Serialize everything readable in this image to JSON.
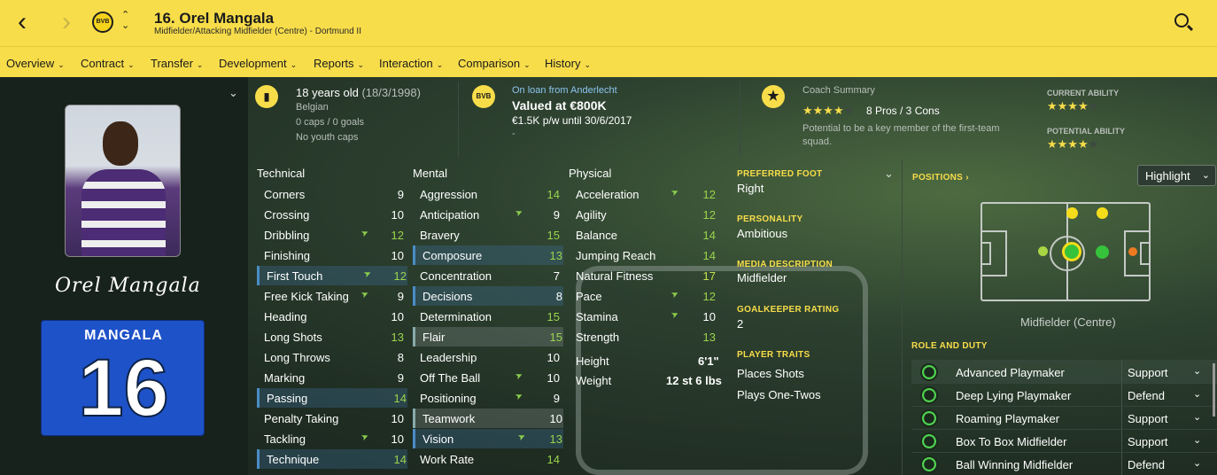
{
  "header": {
    "title": "16. Orel Mangala",
    "subtitle": "Midfielder/Attacking Midfielder (Centre) - Dortmund II",
    "club_crest_text": "BVB",
    "nav_back": "‹",
    "nav_forward": "›",
    "accent": "#f8dd4a"
  },
  "menu": [
    {
      "label": "Overview"
    },
    {
      "label": "Contract"
    },
    {
      "label": "Transfer"
    },
    {
      "label": "Development"
    },
    {
      "label": "Reports"
    },
    {
      "label": "Interaction"
    },
    {
      "label": "Comparison"
    },
    {
      "label": "History"
    }
  ],
  "profile": {
    "signature": "Orel Mangala",
    "shirt_name": "MANGALA",
    "shirt_number": "16"
  },
  "bio": {
    "age": "18 years old",
    "dob": "(18/3/1998)",
    "nationality": "Belgian",
    "caps": "0 caps / 0 goals",
    "youth_caps": "No youth caps"
  },
  "contract": {
    "loan": "On loan from Anderlecht",
    "value": "Valued at €800K",
    "wage": "€1.5K p/w until 30/6/2017",
    "dash": "-"
  },
  "coach": {
    "heading": "Coach Summary",
    "rating_stars": 4,
    "pros_cons": "8 Pros / 3 Cons",
    "summary": "Potential to be a key member of the first-team squad.",
    "current_ability_label": "CURRENT ABILITY",
    "current_ability_stars": 4,
    "potential_ability_label": "POTENTIAL ABILITY",
    "potential_ability_stars": 4
  },
  "attributes": {
    "technical_title": "Technical",
    "mental_title": "Mental",
    "physical_title": "Physical",
    "technical": [
      {
        "name": "Corners",
        "value": "9",
        "arrow": false,
        "hl": "",
        "color": "white"
      },
      {
        "name": "Crossing",
        "value": "10",
        "arrow": false,
        "hl": "",
        "color": "white"
      },
      {
        "name": "Dribbling",
        "value": "12",
        "arrow": true,
        "hl": "",
        "color": "green"
      },
      {
        "name": "Finishing",
        "value": "10",
        "arrow": false,
        "hl": "",
        "color": "white"
      },
      {
        "name": "First Touch",
        "value": "12",
        "arrow": true,
        "hl": "blue",
        "color": "green"
      },
      {
        "name": "Free Kick Taking",
        "value": "9",
        "arrow": true,
        "hl": "",
        "color": "white"
      },
      {
        "name": "Heading",
        "value": "10",
        "arrow": false,
        "hl": "",
        "color": "white"
      },
      {
        "name": "Long Shots",
        "value": "13",
        "arrow": false,
        "hl": "",
        "color": "green"
      },
      {
        "name": "Long Throws",
        "value": "8",
        "arrow": false,
        "hl": "",
        "color": "white"
      },
      {
        "name": "Marking",
        "value": "9",
        "arrow": false,
        "hl": "",
        "color": "white"
      },
      {
        "name": "Passing",
        "value": "14",
        "arrow": false,
        "hl": "blue",
        "color": "green"
      },
      {
        "name": "Penalty Taking",
        "value": "10",
        "arrow": false,
        "hl": "",
        "color": "white"
      },
      {
        "name": "Tackling",
        "value": "10",
        "arrow": true,
        "hl": "",
        "color": "white"
      },
      {
        "name": "Technique",
        "value": "14",
        "arrow": false,
        "hl": "blue",
        "color": "green"
      }
    ],
    "mental": [
      {
        "name": "Aggression",
        "value": "14",
        "arrow": false,
        "hl": "",
        "color": "green"
      },
      {
        "name": "Anticipation",
        "value": "9",
        "arrow": true,
        "hl": "",
        "color": "white"
      },
      {
        "name": "Bravery",
        "value": "15",
        "arrow": false,
        "hl": "",
        "color": "green"
      },
      {
        "name": "Composure",
        "value": "13",
        "arrow": false,
        "hl": "blue",
        "color": "green"
      },
      {
        "name": "Concentration",
        "value": "7",
        "arrow": false,
        "hl": "",
        "color": "white"
      },
      {
        "name": "Decisions",
        "value": "8",
        "arrow": false,
        "hl": "blue",
        "color": "white"
      },
      {
        "name": "Determination",
        "value": "15",
        "arrow": false,
        "hl": "",
        "color": "green"
      },
      {
        "name": "Flair",
        "value": "15",
        "arrow": false,
        "hl": "grey",
        "color": "green"
      },
      {
        "name": "Leadership",
        "value": "10",
        "arrow": false,
        "hl": "",
        "color": "white"
      },
      {
        "name": "Off The Ball",
        "value": "10",
        "arrow": true,
        "hl": "",
        "color": "white"
      },
      {
        "name": "Positioning",
        "value": "9",
        "arrow": true,
        "hl": "",
        "color": "white"
      },
      {
        "name": "Teamwork",
        "value": "10",
        "arrow": false,
        "hl": "grey",
        "color": "white"
      },
      {
        "name": "Vision",
        "value": "13",
        "arrow": true,
        "hl": "blue",
        "color": "green"
      },
      {
        "name": "Work Rate",
        "value": "14",
        "arrow": false,
        "hl": "",
        "color": "green"
      }
    ],
    "physical": [
      {
        "name": "Acceleration",
        "value": "12",
        "arrow": true,
        "hl": "",
        "color": "green"
      },
      {
        "name": "Agility",
        "value": "12",
        "arrow": false,
        "hl": "",
        "color": "green"
      },
      {
        "name": "Balance",
        "value": "14",
        "arrow": false,
        "hl": "",
        "color": "green"
      },
      {
        "name": "Jumping Reach",
        "value": "14",
        "arrow": false,
        "hl": "",
        "color": "green"
      },
      {
        "name": "Natural Fitness",
        "value": "17",
        "arrow": false,
        "hl": "",
        "color": "lime"
      },
      {
        "name": "Pace",
        "value": "12",
        "arrow": true,
        "hl": "",
        "color": "green"
      },
      {
        "name": "Stamina",
        "value": "10",
        "arrow": true,
        "hl": "",
        "color": "white"
      },
      {
        "name": "Strength",
        "value": "13",
        "arrow": false,
        "hl": "",
        "color": "green"
      }
    ],
    "height_label": "Height",
    "height_value": "6'1\"",
    "weight_label": "Weight",
    "weight_value": "12 st 6 lbs"
  },
  "details": {
    "preferred_foot_label": "PREFERRED FOOT",
    "preferred_foot": "Right",
    "personality_label": "PERSONALITY",
    "personality": "Ambitious",
    "media_label": "MEDIA DESCRIPTION",
    "media": "Midfielder",
    "gk_label": "GOALKEEPER RATING",
    "gk": "2",
    "traits_label": "PLAYER TRAITS",
    "traits": [
      "Places Shots",
      "Plays One-Twos"
    ]
  },
  "positions": {
    "label": "POSITIONS",
    "highlight_button": "Highlight",
    "caption": "Midfielder (Centre)",
    "role_label": "ROLE AND DUTY"
  },
  "roles": [
    {
      "name": "Advanced Playmaker",
      "duty": "Support"
    },
    {
      "name": "Deep Lying Playmaker",
      "duty": "Defend"
    },
    {
      "name": "Roaming Playmaker",
      "duty": "Support"
    },
    {
      "name": "Box To Box Midfielder",
      "duty": "Support"
    },
    {
      "name": "Ball Winning Midfielder",
      "duty": "Defend"
    }
  ]
}
